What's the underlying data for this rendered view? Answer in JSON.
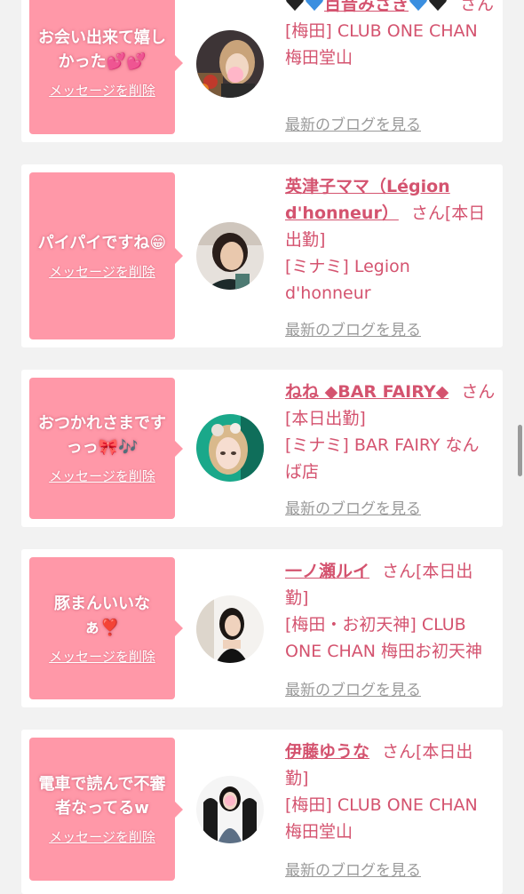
{
  "threads": [
    {
      "message": "お会い出来て嬉しかった💕💕",
      "delete_label": "メッセージを削除",
      "name": "百音みさき",
      "suffix": "さん",
      "shop": "[梅田] CLUB ONE CHAN 梅田堂山",
      "blog_label": "最新のブログを見る"
    },
    {
      "message": "パイパイですね😁",
      "delete_label": "メッセージを削除",
      "name": "英津子ママ（Légion d'honneur）",
      "suffix": "さん[本日出勤]",
      "shop": "[ミナミ] Legion d'honneur",
      "blog_label": "最新のブログを見る"
    },
    {
      "message": "おつかれさまですっっ🎀🎶",
      "delete_label": "メッセージを削除",
      "name": "ねね ◆BAR FAIRY◆",
      "suffix": "さん[本日出勤]",
      "shop": "[ミナミ] BAR FAIRY なんば店",
      "blog_label": "最新のブログを見る"
    },
    {
      "message": "豚まんいいなぁ❣️",
      "delete_label": "メッセージを削除",
      "name": "一ノ瀬ルイ",
      "suffix": "さん[本日出勤]",
      "shop": "[梅田・お初天神] CLUB ONE CHAN 梅田お初天神",
      "blog_label": "最新のブログを見る"
    },
    {
      "message": "電車で読んで不審者なってるw",
      "delete_label": "メッセージを削除",
      "name": "伊藤ゆうな",
      "suffix": "さん[本日出勤]",
      "shop": "[梅田] CLUB ONE CHAN 梅田堂山",
      "blog_label": "最新のブログを見る"
    }
  ],
  "colors": {
    "bubble": "#ff98a8",
    "name_text": "#d4536f",
    "blog_link": "#9a9a9a",
    "background": "#f2f2f2"
  }
}
